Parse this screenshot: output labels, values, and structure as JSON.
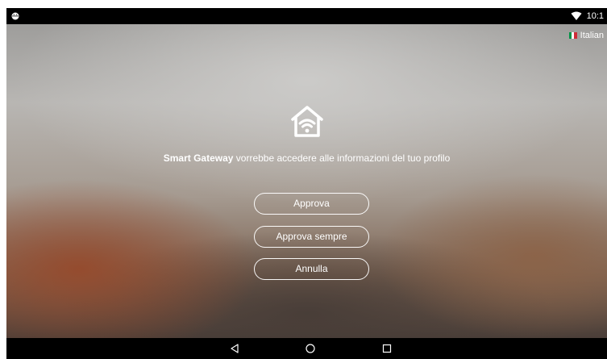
{
  "status_bar": {
    "time": "10:1",
    "icons": [
      "android-icon",
      "wifi-icon"
    ]
  },
  "language": {
    "label": "Italian",
    "flag_colors": [
      "#009246",
      "#ffffff",
      "#ce2b37"
    ]
  },
  "dialog": {
    "app_name": "Smart Gateway",
    "message": " vorrebbe accedere alle informazioni del tuo profilo",
    "icon": "smart-home-wifi-icon",
    "buttons": {
      "approve": "Approva",
      "approve_always": "Approva sempre",
      "cancel": "Annulla"
    }
  },
  "nav_bar": {
    "icons": [
      "back-icon",
      "home-icon",
      "recents-icon"
    ]
  }
}
